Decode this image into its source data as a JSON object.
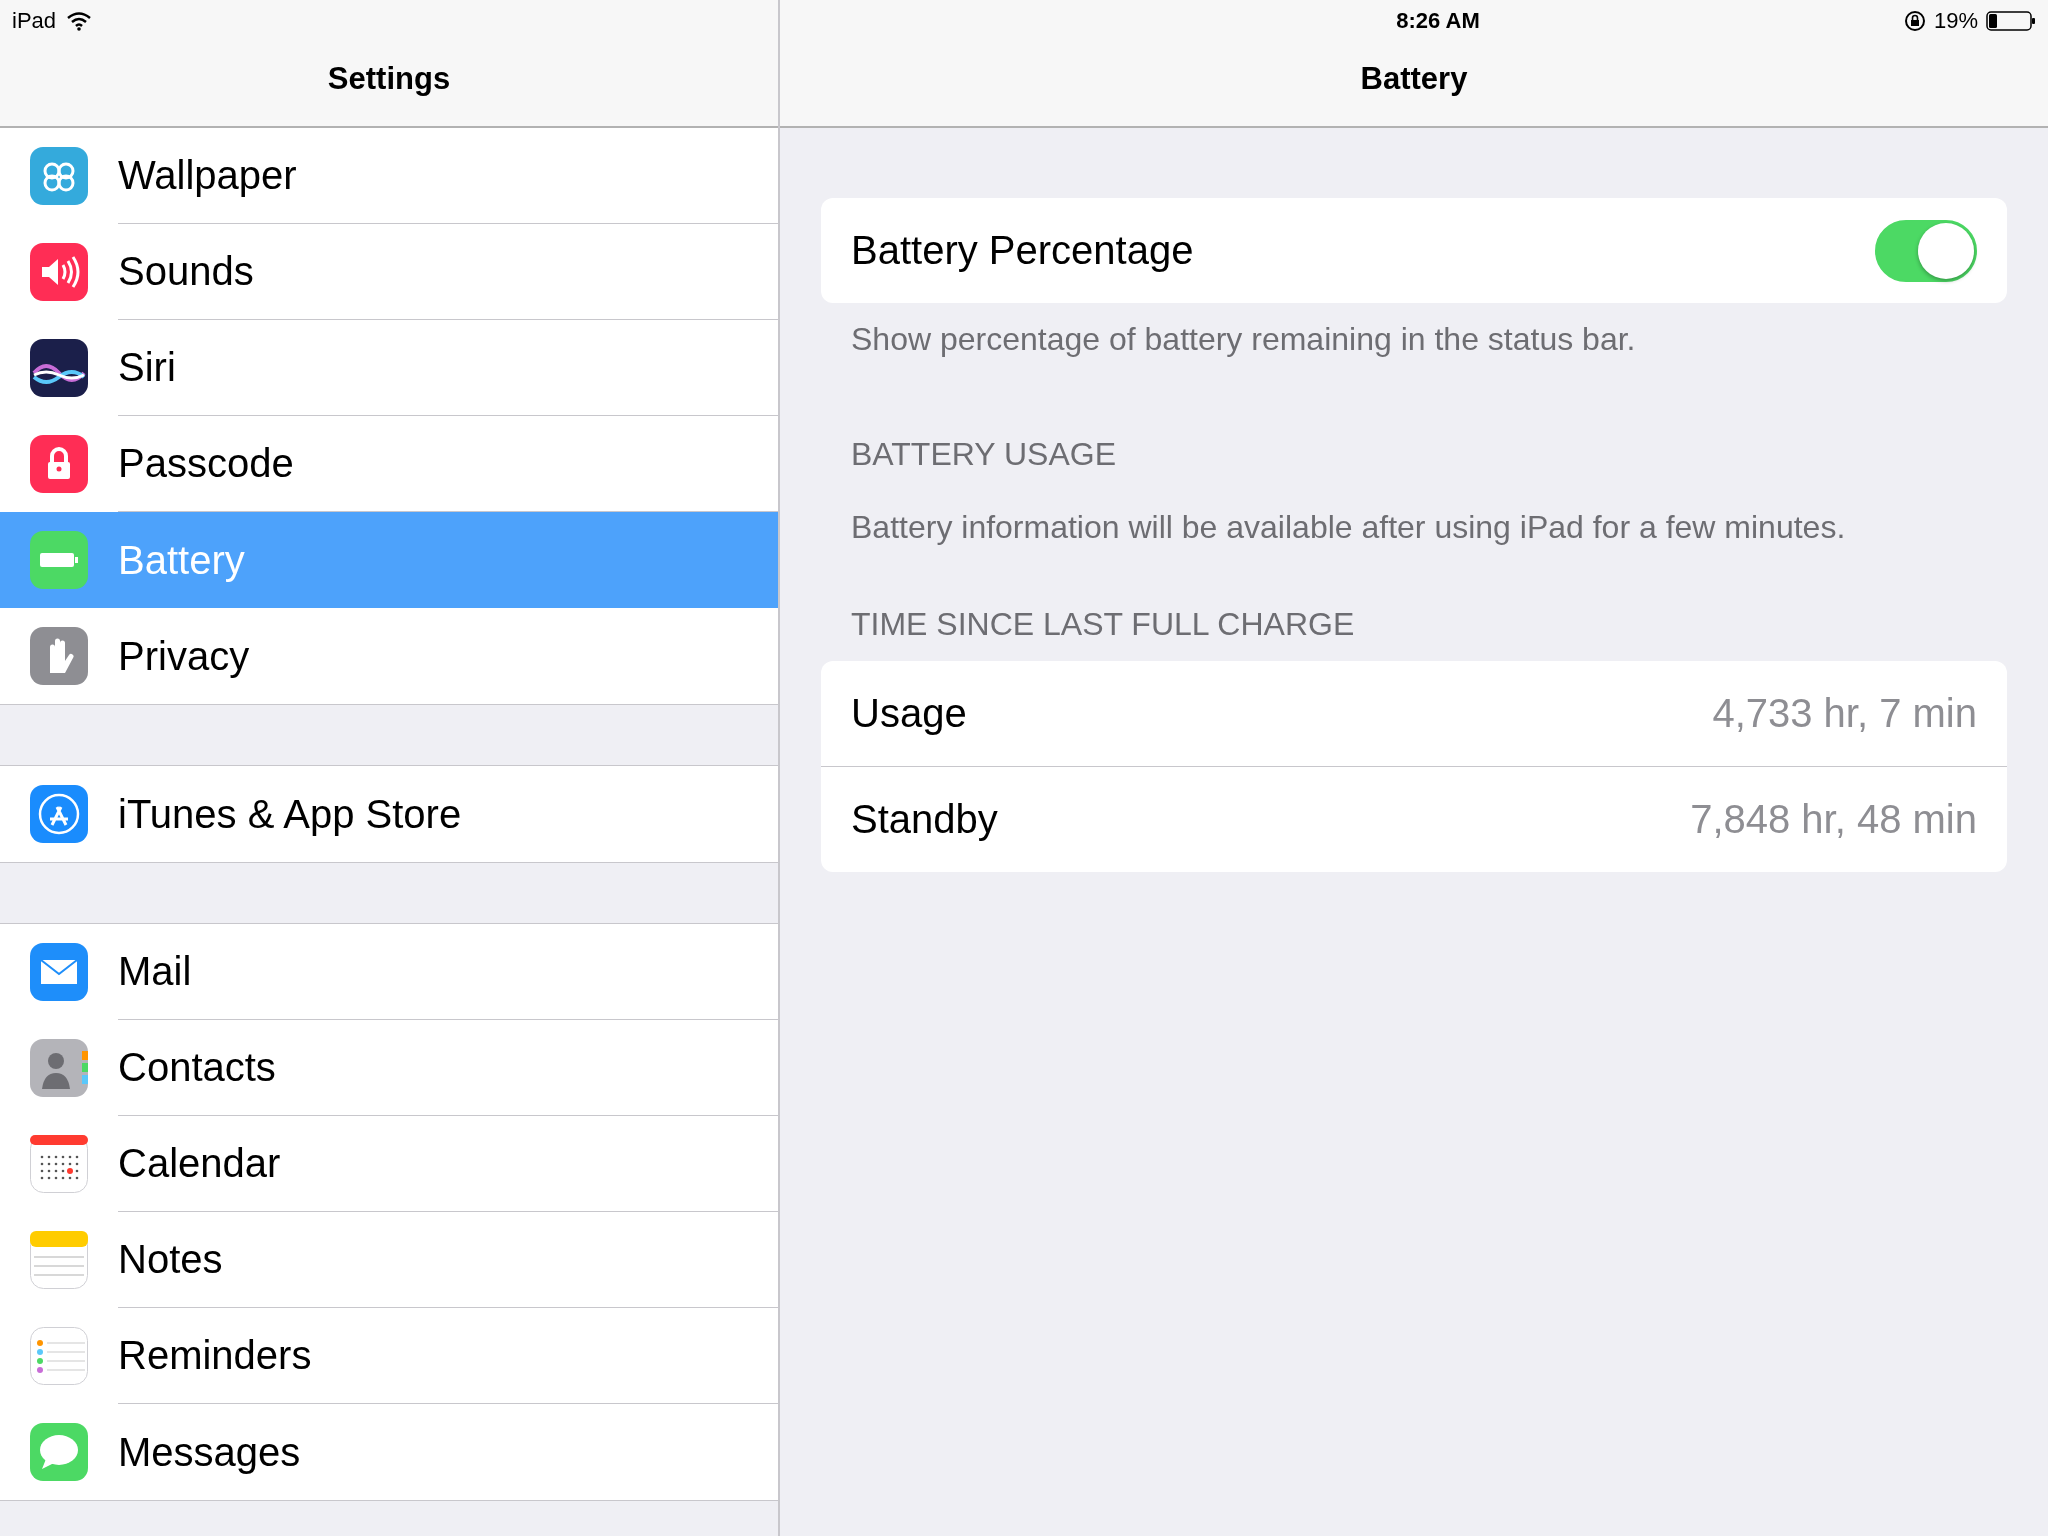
{
  "status_bar": {
    "device": "iPad",
    "time": "8:26 AM",
    "battery_percent": "19%"
  },
  "sidebar": {
    "title": "Settings",
    "groups": [
      {
        "items": [
          {
            "kind": "wallpaper",
            "label": "Wallpaper",
            "selected": false
          },
          {
            "kind": "sounds",
            "label": "Sounds",
            "selected": false
          },
          {
            "kind": "siri",
            "label": "Siri",
            "selected": false
          },
          {
            "kind": "passcode",
            "label": "Passcode",
            "selected": false
          },
          {
            "kind": "battery",
            "label": "Battery",
            "selected": true
          },
          {
            "kind": "privacy",
            "label": "Privacy",
            "selected": false
          }
        ]
      },
      {
        "items": [
          {
            "kind": "store",
            "label": "iTunes & App Store",
            "selected": false
          }
        ]
      },
      {
        "items": [
          {
            "kind": "mail",
            "label": "Mail",
            "selected": false
          },
          {
            "kind": "contacts",
            "label": "Contacts",
            "selected": false
          },
          {
            "kind": "calendar",
            "label": "Calendar",
            "selected": false
          },
          {
            "kind": "notes",
            "label": "Notes",
            "selected": false
          },
          {
            "kind": "reminders",
            "label": "Reminders",
            "selected": false
          },
          {
            "kind": "messages",
            "label": "Messages",
            "selected": false
          }
        ]
      }
    ]
  },
  "detail": {
    "title": "Battery",
    "toggle": {
      "label": "Battery Percentage",
      "on": true
    },
    "toggle_footer": "Show percentage of battery remaining in the status bar.",
    "usage_header": "BATTERY USAGE",
    "usage_note": "Battery information will be available after using iPad for a few minutes.",
    "charge_header": "TIME SINCE LAST FULL CHARGE",
    "charge_rows": [
      {
        "label": "Usage",
        "value": "4,733 hr, 7 min"
      },
      {
        "label": "Standby",
        "value": "7,848 hr, 48 min"
      }
    ]
  }
}
